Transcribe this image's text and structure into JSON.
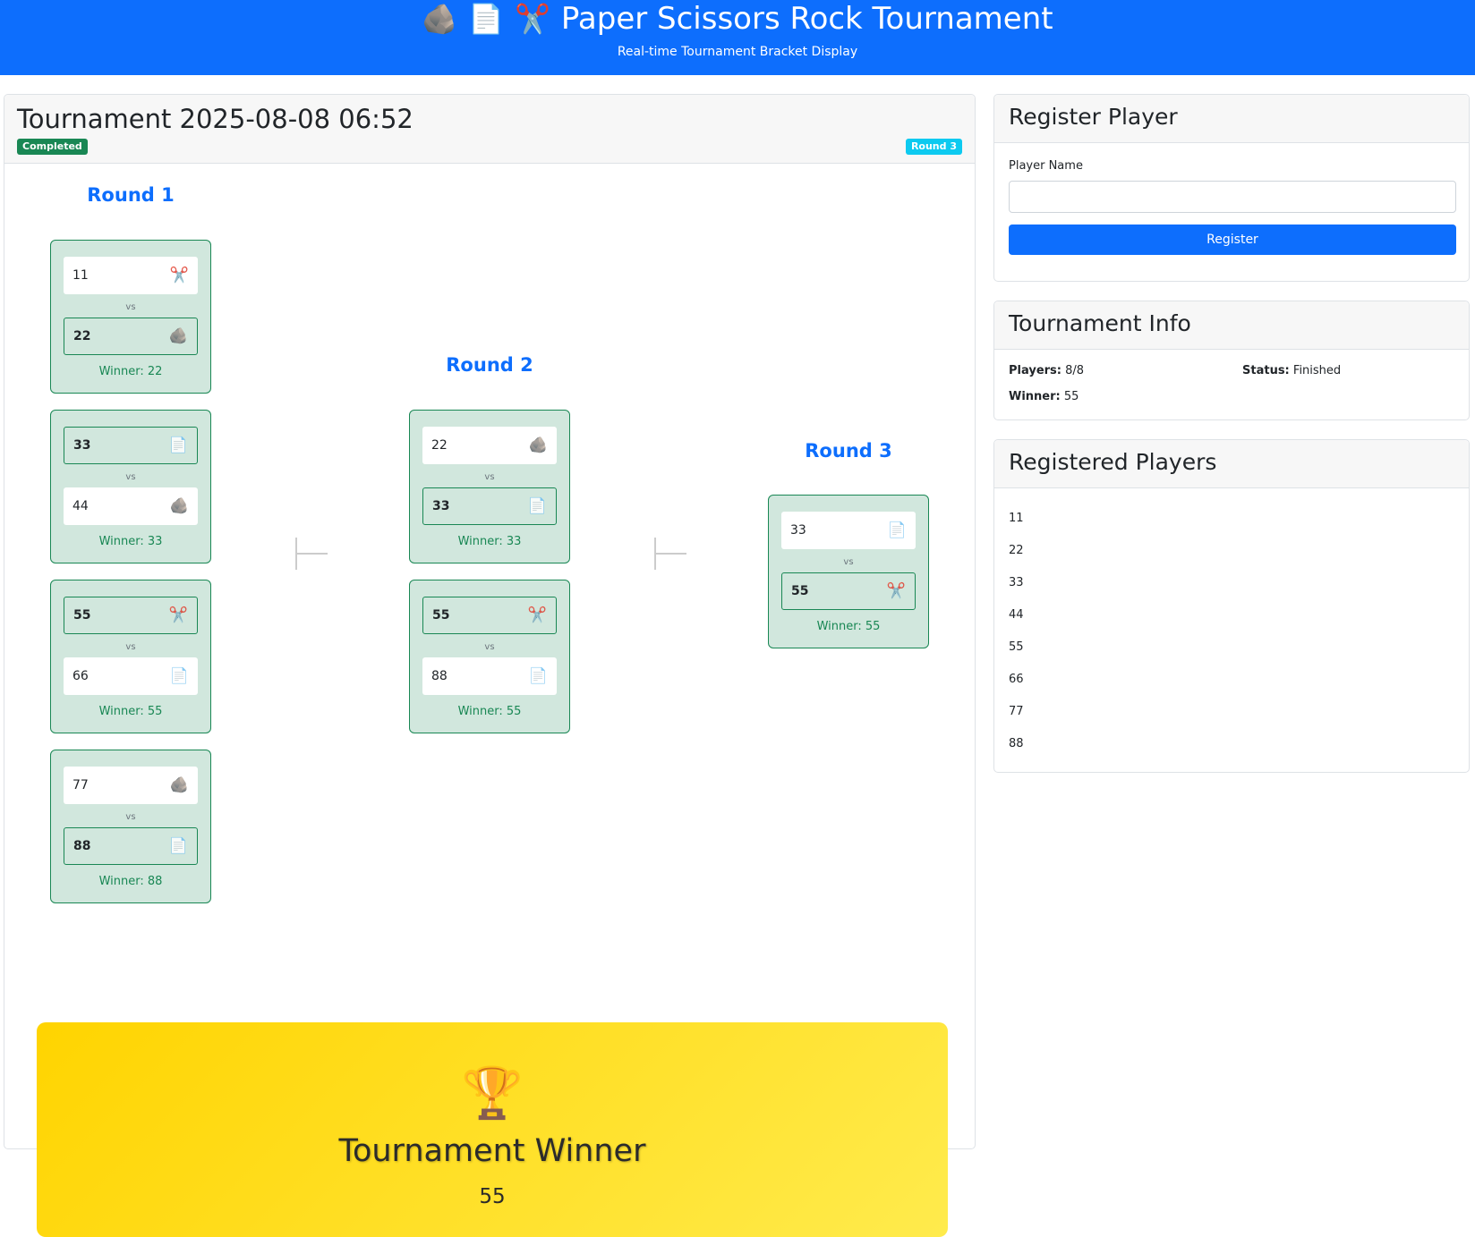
{
  "header": {
    "icons": [
      "🪨",
      "📄",
      "✂️"
    ],
    "icon_names": [
      "rock-icon",
      "paper-icon",
      "scissors-icon"
    ],
    "title": "Paper Scissors Rock Tournament",
    "subtitle": "Real-time Tournament Bracket Display"
  },
  "tournament": {
    "title": "Tournament 2025-08-08 06:52",
    "status_badge": "Completed",
    "round_badge": "Round 3",
    "vs_label": "vs",
    "rounds": [
      {
        "label": "Round 1",
        "matches": [
          {
            "p1": "11",
            "p1_move": "✂️",
            "p2": "22",
            "p2_move": "🪨",
            "winner_slot": 2,
            "winner_text": "Winner: 22"
          },
          {
            "p1": "33",
            "p1_move": "📄",
            "p2": "44",
            "p2_move": "🪨",
            "winner_slot": 1,
            "winner_text": "Winner: 33"
          },
          {
            "p1": "55",
            "p1_move": "✂️",
            "p2": "66",
            "p2_move": "📄",
            "winner_slot": 1,
            "winner_text": "Winner: 55"
          },
          {
            "p1": "77",
            "p1_move": "🪨",
            "p2": "88",
            "p2_move": "📄",
            "winner_slot": 2,
            "winner_text": "Winner: 88"
          }
        ]
      },
      {
        "label": "Round 2",
        "matches": [
          {
            "p1": "22",
            "p1_move": "🪨",
            "p2": "33",
            "p2_move": "📄",
            "winner_slot": 2,
            "winner_text": "Winner: 33"
          },
          {
            "p1": "55",
            "p1_move": "✂️",
            "p2": "88",
            "p2_move": "📄",
            "winner_slot": 1,
            "winner_text": "Winner: 55"
          }
        ]
      },
      {
        "label": "Round 3",
        "matches": [
          {
            "p1": "33",
            "p1_move": "📄",
            "p2": "55",
            "p2_move": "✂️",
            "winner_slot": 2,
            "winner_text": "Winner: 55"
          }
        ]
      }
    ],
    "winner_banner": {
      "trophy": "🏆",
      "title": "Tournament Winner",
      "name": "55"
    }
  },
  "register": {
    "title": "Register Player",
    "label": "Player Name",
    "value": "",
    "button": "Register"
  },
  "info": {
    "title": "Tournament Info",
    "players_label": "Players:",
    "players_value": "8/8",
    "status_label": "Status:",
    "status_value": "Finished",
    "winner_label": "Winner:",
    "winner_value": "55"
  },
  "players": {
    "title": "Registered Players",
    "list": [
      "11",
      "22",
      "33",
      "44",
      "55",
      "66",
      "77",
      "88"
    ]
  },
  "colors": {
    "primary": "#0d6efd",
    "success": "#198754",
    "info": "#0dcaf0",
    "match_bg": "#d1e7dd",
    "banner_gold": "#ffd400"
  }
}
